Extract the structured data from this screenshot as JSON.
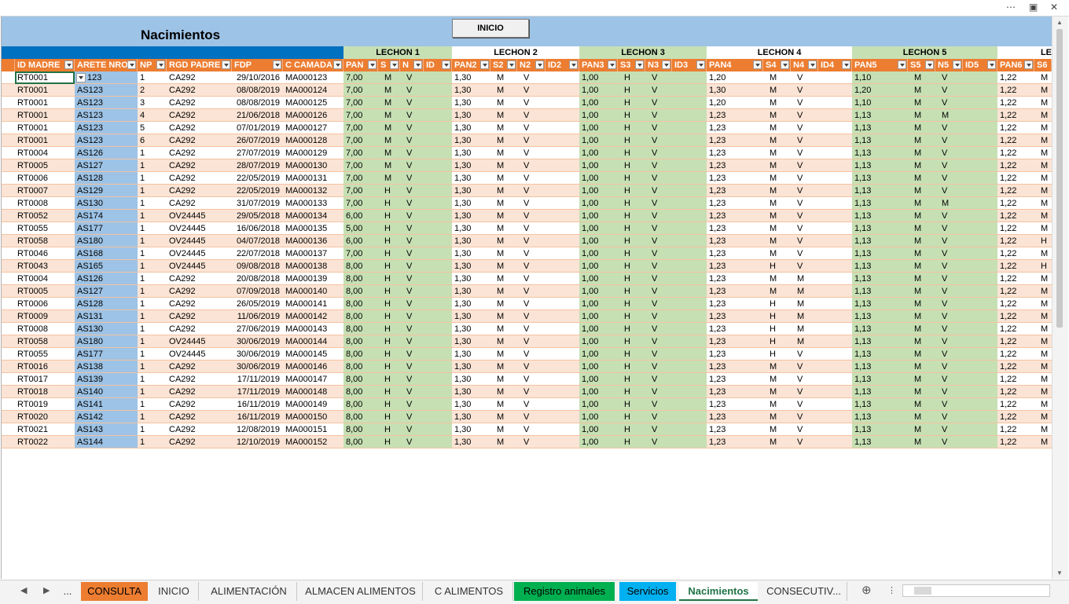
{
  "window": {
    "more_icon": "more-icon",
    "restore_icon": "restore-icon",
    "close_icon": "close-icon"
  },
  "sheet": {
    "title": "Nacimientos",
    "button_inicio": "INICIO"
  },
  "groups": [
    "LECHON 1",
    "LECHON 2",
    "LECHON 3",
    "LECHON 4",
    "LECHON 5",
    "LE"
  ],
  "headers": [
    "ID MADRE",
    "ARETE NRO",
    "NP",
    "RGD PADRE",
    "FDP",
    "C CAMADA",
    "PAN",
    "S",
    "N",
    "ID",
    "PAN2",
    "S2",
    "N2",
    "ID2",
    "PAN3",
    "S3",
    "N3",
    "ID3",
    "PAN4",
    "S4",
    "N4",
    "ID4",
    "PAN5",
    "S5",
    "N5",
    "ID5",
    "PAN6",
    "S6"
  ],
  "rows": [
    [
      "RT0001",
      "123",
      "1",
      "CA292",
      "29/10/2016",
      "MA000123",
      "7,00",
      "M",
      "V",
      "",
      "1,30",
      "M",
      "V",
      "",
      "1,00",
      "H",
      "V",
      "",
      "1,20",
      "M",
      "V",
      "",
      "1,10",
      "M",
      "V",
      "",
      "1,22",
      "M"
    ],
    [
      "RT0001",
      "AS123",
      "2",
      "CA292",
      "08/08/2019",
      "MA000124",
      "7,00",
      "M",
      "V",
      "",
      "1,30",
      "M",
      "V",
      "",
      "1,00",
      "H",
      "V",
      "",
      "1,30",
      "M",
      "V",
      "",
      "1,20",
      "M",
      "V",
      "",
      "1,22",
      "M"
    ],
    [
      "RT0001",
      "AS123",
      "3",
      "CA292",
      "08/08/2019",
      "MA000125",
      "7,00",
      "M",
      "V",
      "",
      "1,30",
      "M",
      "V",
      "",
      "1,00",
      "H",
      "V",
      "",
      "1,20",
      "M",
      "V",
      "",
      "1,10",
      "M",
      "V",
      "",
      "1,22",
      "M"
    ],
    [
      "RT0001",
      "AS123",
      "4",
      "CA292",
      "21/06/2018",
      "MA000126",
      "7,00",
      "M",
      "V",
      "",
      "1,30",
      "M",
      "V",
      "",
      "1,00",
      "H",
      "V",
      "",
      "1,23",
      "M",
      "V",
      "",
      "1,13",
      "M",
      "M",
      "",
      "1,22",
      "M"
    ],
    [
      "RT0001",
      "AS123",
      "5",
      "CA292",
      "07/01/2019",
      "MA000127",
      "7,00",
      "M",
      "V",
      "",
      "1,30",
      "M",
      "V",
      "",
      "1,00",
      "H",
      "V",
      "",
      "1,23",
      "M",
      "V",
      "",
      "1,13",
      "M",
      "V",
      "",
      "1,22",
      "M"
    ],
    [
      "RT0001",
      "AS123",
      "6",
      "CA292",
      "26/07/2019",
      "MA000128",
      "7,00",
      "M",
      "V",
      "",
      "1,30",
      "M",
      "V",
      "",
      "1,00",
      "H",
      "V",
      "",
      "1,23",
      "M",
      "V",
      "",
      "1,13",
      "M",
      "V",
      "",
      "1,22",
      "M"
    ],
    [
      "RT0004",
      "AS126",
      "1",
      "CA292",
      "27/07/2019",
      "MA000129",
      "7,00",
      "M",
      "V",
      "",
      "1,30",
      "M",
      "V",
      "",
      "1,00",
      "H",
      "V",
      "",
      "1,23",
      "M",
      "V",
      "",
      "1,13",
      "M",
      "V",
      "",
      "1,22",
      "M"
    ],
    [
      "RT0005",
      "AS127",
      "1",
      "CA292",
      "28/07/2019",
      "MA000130",
      "7,00",
      "M",
      "V",
      "",
      "1,30",
      "M",
      "V",
      "",
      "1,00",
      "H",
      "V",
      "",
      "1,23",
      "M",
      "V",
      "",
      "1,13",
      "M",
      "V",
      "",
      "1,22",
      "M"
    ],
    [
      "RT0006",
      "AS128",
      "1",
      "CA292",
      "22/05/2019",
      "MA000131",
      "7,00",
      "M",
      "V",
      "",
      "1,30",
      "M",
      "V",
      "",
      "1,00",
      "H",
      "V",
      "",
      "1,23",
      "M",
      "V",
      "",
      "1,13",
      "M",
      "V",
      "",
      "1,22",
      "M"
    ],
    [
      "RT0007",
      "AS129",
      "1",
      "CA292",
      "22/05/2019",
      "MA000132",
      "7,00",
      "H",
      "V",
      "",
      "1,30",
      "M",
      "V",
      "",
      "1,00",
      "H",
      "V",
      "",
      "1,23",
      "M",
      "V",
      "",
      "1,13",
      "M",
      "V",
      "",
      "1,22",
      "M"
    ],
    [
      "RT0008",
      "AS130",
      "1",
      "CA292",
      "31/07/2019",
      "MA000133",
      "7,00",
      "H",
      "V",
      "",
      "1,30",
      "M",
      "V",
      "",
      "1,00",
      "H",
      "V",
      "",
      "1,23",
      "M",
      "V",
      "",
      "1,13",
      "M",
      "M",
      "",
      "1,22",
      "M"
    ],
    [
      "RT0052",
      "AS174",
      "1",
      "OV24445",
      "29/05/2018",
      "MA000134",
      "6,00",
      "H",
      "V",
      "",
      "1,30",
      "M",
      "V",
      "",
      "1,00",
      "H",
      "V",
      "",
      "1,23",
      "M",
      "V",
      "",
      "1,13",
      "M",
      "V",
      "",
      "1,22",
      "M"
    ],
    [
      "RT0055",
      "AS177",
      "1",
      "OV24445",
      "16/06/2018",
      "MA000135",
      "5,00",
      "H",
      "V",
      "",
      "1,30",
      "M",
      "V",
      "",
      "1,00",
      "H",
      "V",
      "",
      "1,23",
      "M",
      "V",
      "",
      "1,13",
      "M",
      "V",
      "",
      "1,22",
      "M"
    ],
    [
      "RT0058",
      "AS180",
      "1",
      "OV24445",
      "04/07/2018",
      "MA000136",
      "6,00",
      "H",
      "V",
      "",
      "1,30",
      "M",
      "V",
      "",
      "1,00",
      "H",
      "V",
      "",
      "1,23",
      "M",
      "V",
      "",
      "1,13",
      "M",
      "V",
      "",
      "1,22",
      "H"
    ],
    [
      "RT0046",
      "AS168",
      "1",
      "OV24445",
      "22/07/2018",
      "MA000137",
      "7,00",
      "H",
      "V",
      "",
      "1,30",
      "M",
      "V",
      "",
      "1,00",
      "H",
      "V",
      "",
      "1,23",
      "M",
      "V",
      "",
      "1,13",
      "M",
      "V",
      "",
      "1,22",
      "M"
    ],
    [
      "RT0043",
      "AS165",
      "1",
      "OV24445",
      "09/08/2018",
      "MA000138",
      "8,00",
      "H",
      "V",
      "",
      "1,30",
      "M",
      "V",
      "",
      "1,00",
      "H",
      "V",
      "",
      "1,23",
      "H",
      "V",
      "",
      "1,13",
      "M",
      "V",
      "",
      "1,22",
      "H"
    ],
    [
      "RT0004",
      "AS126",
      "1",
      "CA292",
      "20/08/2018",
      "MA000139",
      "8,00",
      "H",
      "V",
      "",
      "1,30",
      "M",
      "V",
      "",
      "1,00",
      "H",
      "V",
      "",
      "1,23",
      "M",
      "M",
      "",
      "1,13",
      "M",
      "V",
      "",
      "1,22",
      "M"
    ],
    [
      "RT0005",
      "AS127",
      "1",
      "CA292",
      "07/09/2018",
      "MA000140",
      "8,00",
      "H",
      "V",
      "",
      "1,30",
      "M",
      "V",
      "",
      "1,00",
      "H",
      "V",
      "",
      "1,23",
      "M",
      "M",
      "",
      "1,13",
      "M",
      "V",
      "",
      "1,22",
      "M"
    ],
    [
      "RT0006",
      "AS128",
      "1",
      "CA292",
      "26/05/2019",
      "MA000141",
      "8,00",
      "H",
      "V",
      "",
      "1,30",
      "M",
      "V",
      "",
      "1,00",
      "H",
      "V",
      "",
      "1,23",
      "H",
      "M",
      "",
      "1,13",
      "M",
      "V",
      "",
      "1,22",
      "M"
    ],
    [
      "RT0009",
      "AS131",
      "1",
      "CA292",
      "11/06/2019",
      "MA000142",
      "8,00",
      "H",
      "V",
      "",
      "1,30",
      "M",
      "V",
      "",
      "1,00",
      "H",
      "V",
      "",
      "1,23",
      "H",
      "M",
      "",
      "1,13",
      "M",
      "V",
      "",
      "1,22",
      "M"
    ],
    [
      "RT0008",
      "AS130",
      "1",
      "CA292",
      "27/06/2019",
      "MA000143",
      "8,00",
      "H",
      "V",
      "",
      "1,30",
      "M",
      "V",
      "",
      "1,00",
      "H",
      "V",
      "",
      "1,23",
      "H",
      "M",
      "",
      "1,13",
      "M",
      "V",
      "",
      "1,22",
      "M"
    ],
    [
      "RT0058",
      "AS180",
      "1",
      "OV24445",
      "30/06/2019",
      "MA000144",
      "8,00",
      "H",
      "V",
      "",
      "1,30",
      "M",
      "V",
      "",
      "1,00",
      "H",
      "V",
      "",
      "1,23",
      "H",
      "M",
      "",
      "1,13",
      "M",
      "V",
      "",
      "1,22",
      "M"
    ],
    [
      "RT0055",
      "AS177",
      "1",
      "OV24445",
      "30/06/2019",
      "MA000145",
      "8,00",
      "H",
      "V",
      "",
      "1,30",
      "M",
      "V",
      "",
      "1,00",
      "H",
      "V",
      "",
      "1,23",
      "H",
      "V",
      "",
      "1,13",
      "M",
      "V",
      "",
      "1,22",
      "M"
    ],
    [
      "RT0016",
      "AS138",
      "1",
      "CA292",
      "30/06/2019",
      "MA000146",
      "8,00",
      "H",
      "V",
      "",
      "1,30",
      "M",
      "V",
      "",
      "1,00",
      "H",
      "V",
      "",
      "1,23",
      "M",
      "V",
      "",
      "1,13",
      "M",
      "V",
      "",
      "1,22",
      "M"
    ],
    [
      "RT0017",
      "AS139",
      "1",
      "CA292",
      "17/11/2019",
      "MA000147",
      "8,00",
      "H",
      "V",
      "",
      "1,30",
      "M",
      "V",
      "",
      "1,00",
      "H",
      "V",
      "",
      "1,23",
      "M",
      "V",
      "",
      "1,13",
      "M",
      "V",
      "",
      "1,22",
      "M"
    ],
    [
      "RT0018",
      "AS140",
      "1",
      "CA292",
      "17/11/2019",
      "MA000148",
      "8,00",
      "H",
      "V",
      "",
      "1,30",
      "M",
      "V",
      "",
      "1,00",
      "H",
      "V",
      "",
      "1,23",
      "M",
      "V",
      "",
      "1,13",
      "M",
      "V",
      "",
      "1,22",
      "M"
    ],
    [
      "RT0019",
      "AS141",
      "1",
      "CA292",
      "16/11/2019",
      "MA000149",
      "8,00",
      "H",
      "V",
      "",
      "1,30",
      "M",
      "V",
      "",
      "1,00",
      "H",
      "V",
      "",
      "1,23",
      "M",
      "V",
      "",
      "1,13",
      "M",
      "V",
      "",
      "1,22",
      "M"
    ],
    [
      "RT0020",
      "AS142",
      "1",
      "CA292",
      "16/11/2019",
      "MA000150",
      "8,00",
      "H",
      "V",
      "",
      "1,30",
      "M",
      "V",
      "",
      "1,00",
      "H",
      "V",
      "",
      "1,23",
      "M",
      "V",
      "",
      "1,13",
      "M",
      "V",
      "",
      "1,22",
      "M"
    ],
    [
      "RT0021",
      "AS143",
      "1",
      "CA292",
      "12/08/2019",
      "MA000151",
      "8,00",
      "H",
      "V",
      "",
      "1,30",
      "M",
      "V",
      "",
      "1,00",
      "H",
      "V",
      "",
      "1,23",
      "M",
      "V",
      "",
      "1,13",
      "M",
      "V",
      "",
      "1,22",
      "M"
    ],
    [
      "RT0022",
      "AS144",
      "1",
      "CA292",
      "12/10/2019",
      "MA000152",
      "8,00",
      "H",
      "V",
      "",
      "1,30",
      "M",
      "V",
      "",
      "1,00",
      "H",
      "V",
      "",
      "1,23",
      "M",
      "V",
      "",
      "1,13",
      "M",
      "V",
      "",
      "1,22",
      "M"
    ]
  ],
  "tabs": [
    {
      "label": "...",
      "style": "plain"
    },
    {
      "label": "CONSULTA",
      "style": "orange"
    },
    {
      "label": "INICIO",
      "style": "plain"
    },
    {
      "label": "ALIMENTACIÓN",
      "style": "plain"
    },
    {
      "label": "ALMACEN ALIMENTOS",
      "style": "plain"
    },
    {
      "label": "C ALIMENTOS",
      "style": "plain"
    },
    {
      "label": "Registro animales",
      "style": "green"
    },
    {
      "label": "Servicios",
      "style": "blue"
    },
    {
      "label": "Nacimientos",
      "style": "active"
    },
    {
      "label": "CONSECUTIV...",
      "style": "plain"
    }
  ],
  "add_sheet_icon": "plus-circle-icon",
  "colors": {
    "header_orange": "#ed7d31",
    "band_blue": "#9dc3e6",
    "group_green": "#c6e0b4",
    "row_peach": "#fbe4d5",
    "accent_green": "#217346"
  }
}
